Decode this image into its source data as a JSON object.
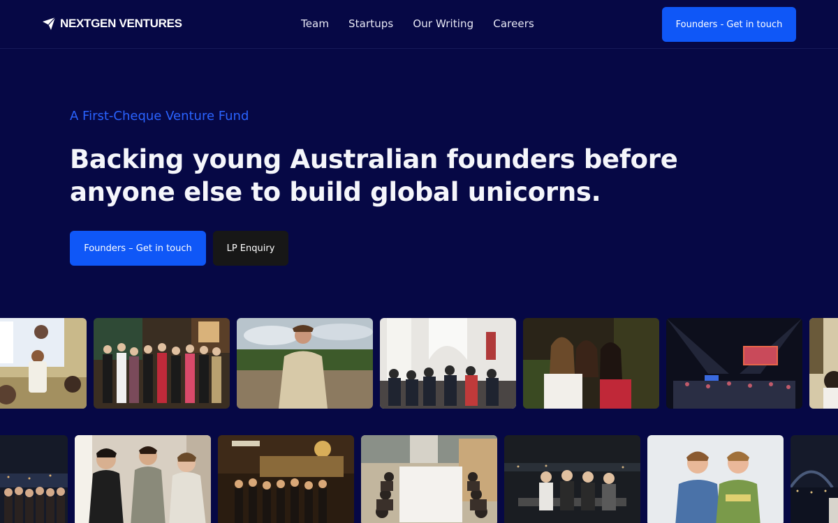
{
  "nav": {
    "brand": "NEXTGEN VENTURES",
    "links": [
      "Team",
      "Startups",
      "Our Writing",
      "Careers"
    ],
    "cta": "Founders - Get in touch"
  },
  "hero": {
    "eyebrow": "A First-Cheque Venture Fund",
    "headline": "Backing young Australian founders before anyone else to build global unicorns.",
    "primary_button": "Founders – Get in touch",
    "secondary_button": "LP Enquiry"
  },
  "colors": {
    "background": "#060845",
    "accent": "#0f57f7",
    "eyebrow": "#2a63ff",
    "secondary_button": "#171717"
  },
  "gallery": {
    "row1": [
      "photo-presentation",
      "photo-group-pub",
      "photo-field-portrait",
      "photo-living-room-meetup",
      "photo-three-friends-night",
      "photo-event-stage",
      "photo-partial-edge"
    ],
    "row2": [
      "photo-night-harbour-group",
      "photo-three-people-talking",
      "photo-street-group-night",
      "photo-long-table-dinner",
      "photo-night-terrace",
      "photo-two-founders",
      "photo-harbour-bridge-night"
    ]
  }
}
